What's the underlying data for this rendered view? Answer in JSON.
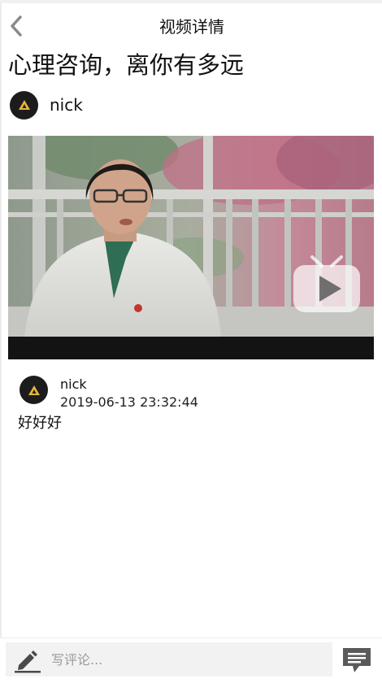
{
  "header": {
    "title": "视频详情",
    "back_icon": "chevron-left-icon"
  },
  "article": {
    "title": "心理咨询，离你有多远",
    "author": {
      "name": "nick",
      "avatar_icon": "logo-avatar-icon"
    }
  },
  "video": {
    "overlay_icon": "tv-play-icon"
  },
  "comments": [
    {
      "name": "nick",
      "time": "2019-06-13 23:32:44",
      "text": "好好好"
    }
  ],
  "bottom_bar": {
    "placeholder": "写评论...",
    "edit_icon": "pen-icon",
    "comments_icon": "comment-list-icon"
  },
  "colors": {
    "avatar_bg": "#1c1c1c",
    "avatar_logo": "#e7b43a",
    "input_bg": "#f2f2f2"
  }
}
